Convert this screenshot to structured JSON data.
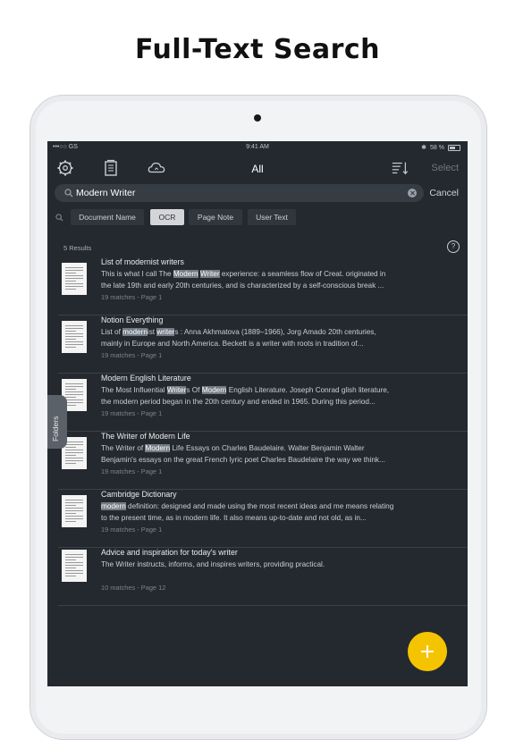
{
  "headline": "Full-Text Search",
  "status": {
    "carrier": "•••○○ GS",
    "time": "9:41 AM",
    "battery": "58 %"
  },
  "toolbar": {
    "title": "All",
    "select_label": "Select"
  },
  "search": {
    "value": "Modern Writer",
    "cancel_label": "Cancel"
  },
  "filters": [
    {
      "label": "Document Name",
      "active": false
    },
    {
      "label": "OCR",
      "active": true
    },
    {
      "label": "Page Note",
      "active": false
    },
    {
      "label": "User Text",
      "active": false
    }
  ],
  "results_count": "5 Results",
  "help_label": "?",
  "folders_label": "Folders",
  "results": [
    {
      "title": "List of modernist writers",
      "line1": [
        [
          "This is what I call The ",
          false
        ],
        [
          "Modern",
          true
        ],
        [
          " ",
          false
        ],
        [
          "Writer",
          true
        ],
        [
          " experience: a seamless flow of Creat. originated in",
          false
        ]
      ],
      "line2": [
        [
          "the late 19th and early 20th centuries, and is characterized by a self-conscious break ...",
          false
        ]
      ],
      "meta": "19 matches - Page 1"
    },
    {
      "title": "Notion Everything",
      "line1": [
        [
          "List of ",
          false
        ],
        [
          "modern",
          true
        ],
        [
          "ist ",
          false
        ],
        [
          "writer",
          true
        ],
        [
          "s : Anna Akhmatova (1889–1966), Jorg Amado 20th centuries,",
          false
        ]
      ],
      "line2": [
        [
          "mainly in Europe and North America. Beckett is a writer with roots in tradition of...",
          false
        ]
      ],
      "meta": "19 matches - Page 1"
    },
    {
      "title": "Modern English Literature",
      "line1": [
        [
          "The Most Influential ",
          false
        ],
        [
          "Writer",
          true
        ],
        [
          "s Of ",
          false
        ],
        [
          "Modern",
          true
        ],
        [
          " English Literature. Joseph Conrad glish literature,",
          false
        ]
      ],
      "line2": [
        [
          "the modern period began in the 20th century and ended in 1965. During this period...",
          false
        ]
      ],
      "meta": "19 matches - Page 1"
    },
    {
      "title": "The Writer of Modern Life",
      "line1": [
        [
          "The Writer of ",
          false
        ],
        [
          "Modern",
          true
        ],
        [
          " Life Essays on Charles Baudelaire. Walter Benjamin Walter",
          false
        ]
      ],
      "line2": [
        [
          "Benjamin's essays on the great French lyric poet Charles Baudelaire the way we think...",
          false
        ]
      ],
      "meta": "19 matches - Page 1"
    },
    {
      "title": "Cambridge Dictionary",
      "line1": [
        [
          "modern",
          true
        ],
        [
          " definition: designed and made using the most recent ideas and me means relating",
          false
        ]
      ],
      "line2": [
        [
          "to the present time, as in modern life. It also means up-to-date and not old, as in...",
          false
        ]
      ],
      "meta": "19 matches - Page 1"
    },
    {
      "title": "Advice and inspiration for today's writer",
      "line1": [
        [
          "The Writer instructs, informs, and inspires writers, providing practical.",
          false
        ]
      ],
      "line2": [],
      "meta": "10 matches - Page 12"
    }
  ]
}
